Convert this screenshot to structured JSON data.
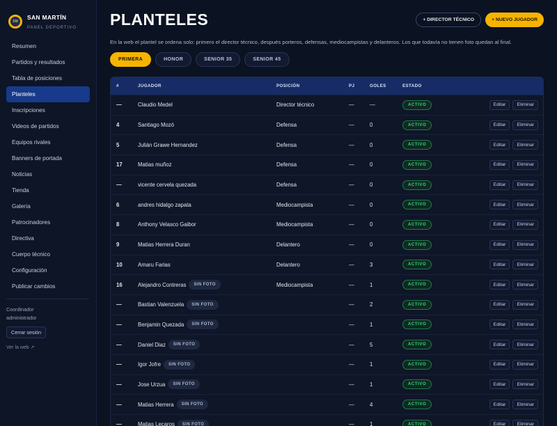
{
  "brand": {
    "name": "SAN MARTÍN",
    "subtitle": "PANEL DEPORTIVO",
    "logo_text": "SM"
  },
  "sidebar": {
    "items": [
      {
        "label": "Resumen"
      },
      {
        "label": "Partidos y resultados"
      },
      {
        "label": "Tabla de posiciones"
      },
      {
        "label": "Planteles",
        "active": true
      },
      {
        "label": "Inscripciones"
      },
      {
        "label": "Videos de partidos"
      },
      {
        "label": "Equipos rivales"
      },
      {
        "label": "Banners de portada"
      },
      {
        "label": "Noticias"
      },
      {
        "label": "Tienda"
      },
      {
        "label": "Galería"
      },
      {
        "label": "Patrocinadores"
      },
      {
        "label": "Directiva"
      },
      {
        "label": "Cuerpo técnico"
      },
      {
        "label": "Configuración"
      },
      {
        "label": "Publicar cambios"
      }
    ],
    "role_line1": "Coordinador",
    "role_line2": "administrador",
    "logout_label": "Cerrar sesión",
    "view_web_label": "Ver la web ↗"
  },
  "header": {
    "title": "PLANTELES",
    "btn_director": "+ DIRECTOR TÉCNICO",
    "btn_player": "+ NUEVO JUGADOR"
  },
  "intro": "En la web el plantel se ordena solo: primero el director técnico, después porteros, defensas, mediocampistas y delanteros. Los que todavía no tienen foto quedan al final.",
  "tabs": [
    {
      "label": "PRIMERA",
      "active": true
    },
    {
      "label": "HONOR"
    },
    {
      "label": "SENIOR 35"
    },
    {
      "label": "SENIOR 45"
    }
  ],
  "table": {
    "headers": {
      "num": "#",
      "player": "JUGADOR",
      "position": "POSICIÓN",
      "pj": "PJ",
      "goals": "GOLES",
      "status": "ESTADO"
    },
    "no_photo_label": "SIN FOTO",
    "edit_label": "Editar",
    "delete_label": "Eliminar",
    "rows": [
      {
        "num": "—",
        "name": "Claudio Medel",
        "nofoto": false,
        "position": "Director técnico",
        "pj": "—",
        "goals": "—",
        "status": "ACTIVO"
      },
      {
        "num": "4",
        "name": "Santiago Mozó",
        "nofoto": false,
        "position": "Defensa",
        "pj": "—",
        "goals": "0",
        "status": "ACTIVO"
      },
      {
        "num": "5",
        "name": "Julián Grawe Hernandez",
        "nofoto": false,
        "position": "Defensa",
        "pj": "—",
        "goals": "0",
        "status": "ACTIVO"
      },
      {
        "num": "17",
        "name": "Matias muñoz",
        "nofoto": false,
        "position": "Defensa",
        "pj": "—",
        "goals": "0",
        "status": "ACTIVO"
      },
      {
        "num": "—",
        "name": "vicente cervela quezada",
        "nofoto": false,
        "position": "Defensa",
        "pj": "—",
        "goals": "0",
        "status": "ACTIVO"
      },
      {
        "num": "6",
        "name": "andres hidalgo zapata",
        "nofoto": false,
        "position": "Mediocampista",
        "pj": "—",
        "goals": "0",
        "status": "ACTIVO"
      },
      {
        "num": "8",
        "name": "Anthony Velasco Gaibor",
        "nofoto": false,
        "position": "Mediocampista",
        "pj": "—",
        "goals": "0",
        "status": "ACTIVO"
      },
      {
        "num": "9",
        "name": "Matias Herrera Duran",
        "nofoto": false,
        "position": "Delantero",
        "pj": "—",
        "goals": "0",
        "status": "ACTIVO"
      },
      {
        "num": "10",
        "name": "Amaru Farias",
        "nofoto": false,
        "position": "Delantero",
        "pj": "—",
        "goals": "3",
        "status": "ACTIVO"
      },
      {
        "num": "16",
        "name": "Alejandro Contreras",
        "nofoto": true,
        "position": "Mediocampista",
        "pj": "—",
        "goals": "1",
        "status": "ACTIVO"
      },
      {
        "num": "—",
        "name": "Bastian Valenzuela",
        "nofoto": true,
        "position": "",
        "pj": "—",
        "goals": "2",
        "status": "ACTIVO"
      },
      {
        "num": "—",
        "name": "Benjamin Quezada",
        "nofoto": true,
        "position": "",
        "pj": "—",
        "goals": "1",
        "status": "ACTIVO"
      },
      {
        "num": "—",
        "name": "Daniel Diaz",
        "nofoto": true,
        "position": "",
        "pj": "—",
        "goals": "5",
        "status": "ACTIVO"
      },
      {
        "num": "—",
        "name": "Igor Jofre",
        "nofoto": true,
        "position": "",
        "pj": "—",
        "goals": "1",
        "status": "ACTIVO"
      },
      {
        "num": "—",
        "name": "Jose Urzua",
        "nofoto": true,
        "position": "",
        "pj": "—",
        "goals": "1",
        "status": "ACTIVO"
      },
      {
        "num": "—",
        "name": "Matias Herrera",
        "nofoto": true,
        "position": "",
        "pj": "—",
        "goals": "4",
        "status": "ACTIVO"
      },
      {
        "num": "—",
        "name": "Matias Lecaros",
        "nofoto": true,
        "position": "",
        "pj": "—",
        "goals": "1",
        "status": "ACTIVO"
      }
    ]
  },
  "colors": {
    "accent": "#f5b400",
    "nav_active": "#173a8a",
    "table_header": "#172c66",
    "status_green": "#39d37f"
  }
}
